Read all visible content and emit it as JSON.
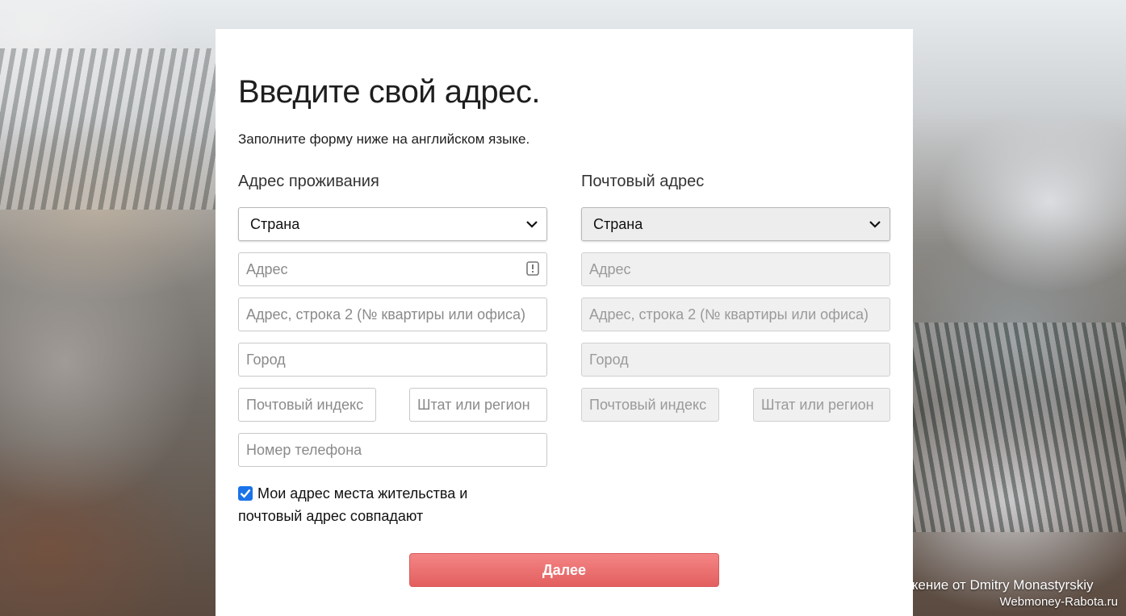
{
  "form": {
    "title": "Введите свой адрес.",
    "subtitle": "Заполните форму ниже на английском языке.",
    "residential": {
      "heading": "Адрес проживания",
      "country_value": "Страна",
      "address_placeholder": "Адрес",
      "address2_placeholder": "Адрес, строка 2 (№ квартиры или офиса)",
      "city_placeholder": "Город",
      "postal_placeholder": "Почтовый индекс",
      "state_placeholder": "Штат или регион",
      "phone_placeholder": "Номер телефона"
    },
    "mailing": {
      "heading": "Почтовый адрес",
      "country_value": "Страна",
      "address_placeholder": "Адрес",
      "address2_placeholder": "Адрес, строка 2 (№ квартиры или офиса)",
      "city_placeholder": "Город",
      "postal_placeholder": "Почтовый индекс",
      "state_placeholder": "Штат или регион"
    },
    "same_address_checkbox": {
      "label": "Мои адрес места жительства и почтовый адрес совпадают",
      "checked": true
    },
    "next_button": "Далее"
  },
  "background": {
    "credit": "жение от Dmitry Monastyrskiy",
    "watermark": "Webmoney-Rabota.ru"
  },
  "colors": {
    "accent_button": "#e86a6a",
    "checkbox": "#1a73e8"
  }
}
